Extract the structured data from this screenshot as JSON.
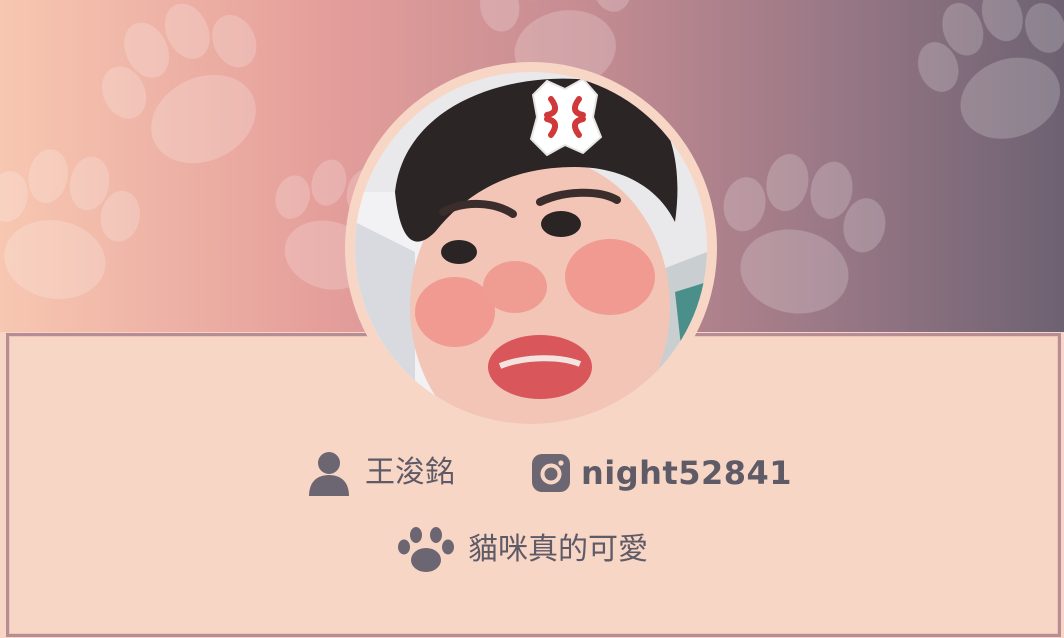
{
  "profile": {
    "name": "王浚銘",
    "instagram_handle": "night52841",
    "bio": "貓咪真的可愛"
  },
  "icons": {
    "name": "user-icon",
    "instagram": "instagram-icon",
    "bio": "paw-icon"
  },
  "colors": {
    "banner_start": "#f7c7b1",
    "banner_mid": "#c58c92",
    "banner_end": "#6d6272",
    "card_background": "#f8d6c6",
    "card_border": "#b68c95",
    "text": "#5e5a66"
  }
}
